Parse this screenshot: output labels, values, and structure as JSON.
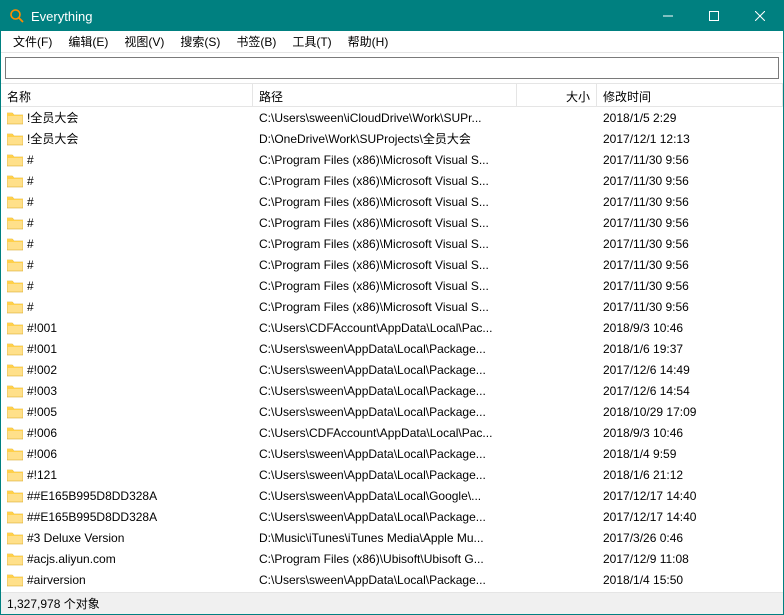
{
  "window": {
    "title": "Everything"
  },
  "menu": {
    "items": [
      {
        "label": "文件(F)"
      },
      {
        "label": "编辑(E)"
      },
      {
        "label": "视图(V)"
      },
      {
        "label": "搜索(S)"
      },
      {
        "label": "书签(B)"
      },
      {
        "label": "工具(T)"
      },
      {
        "label": "帮助(H)"
      }
    ]
  },
  "search": {
    "value": "",
    "placeholder": ""
  },
  "columns": {
    "name": "名称",
    "path": "路径",
    "size": "大小",
    "date": "修改时间"
  },
  "rows": [
    {
      "name": "!全员大会",
      "path": "C:\\Users\\sween\\iCloudDrive\\Work\\SUPr...",
      "size": "",
      "date": "2018/1/5 2:29"
    },
    {
      "name": "!全员大会",
      "path": "D:\\OneDrive\\Work\\SUProjects\\全员大会",
      "size": "",
      "date": "2017/12/1 12:13"
    },
    {
      "name": "#",
      "path": "C:\\Program Files (x86)\\Microsoft Visual S...",
      "size": "",
      "date": "2017/11/30 9:56"
    },
    {
      "name": "#",
      "path": "C:\\Program Files (x86)\\Microsoft Visual S...",
      "size": "",
      "date": "2017/11/30 9:56"
    },
    {
      "name": "#",
      "path": "C:\\Program Files (x86)\\Microsoft Visual S...",
      "size": "",
      "date": "2017/11/30 9:56"
    },
    {
      "name": "#",
      "path": "C:\\Program Files (x86)\\Microsoft Visual S...",
      "size": "",
      "date": "2017/11/30 9:56"
    },
    {
      "name": "#",
      "path": "C:\\Program Files (x86)\\Microsoft Visual S...",
      "size": "",
      "date": "2017/11/30 9:56"
    },
    {
      "name": "#",
      "path": "C:\\Program Files (x86)\\Microsoft Visual S...",
      "size": "",
      "date": "2017/11/30 9:56"
    },
    {
      "name": "#",
      "path": "C:\\Program Files (x86)\\Microsoft Visual S...",
      "size": "",
      "date": "2017/11/30 9:56"
    },
    {
      "name": "#",
      "path": "C:\\Program Files (x86)\\Microsoft Visual S...",
      "size": "",
      "date": "2017/11/30 9:56"
    },
    {
      "name": "#!001",
      "path": "C:\\Users\\CDFAccount\\AppData\\Local\\Pac...",
      "size": "",
      "date": "2018/9/3 10:46"
    },
    {
      "name": "#!001",
      "path": "C:\\Users\\sween\\AppData\\Local\\Package...",
      "size": "",
      "date": "2018/1/6 19:37"
    },
    {
      "name": "#!002",
      "path": "C:\\Users\\sween\\AppData\\Local\\Package...",
      "size": "",
      "date": "2017/12/6 14:49"
    },
    {
      "name": "#!003",
      "path": "C:\\Users\\sween\\AppData\\Local\\Package...",
      "size": "",
      "date": "2017/12/6 14:54"
    },
    {
      "name": "#!005",
      "path": "C:\\Users\\sween\\AppData\\Local\\Package...",
      "size": "",
      "date": "2018/10/29 17:09"
    },
    {
      "name": "#!006",
      "path": "C:\\Users\\CDFAccount\\AppData\\Local\\Pac...",
      "size": "",
      "date": "2018/9/3 10:46"
    },
    {
      "name": "#!006",
      "path": "C:\\Users\\sween\\AppData\\Local\\Package...",
      "size": "",
      "date": "2018/1/4 9:59"
    },
    {
      "name": "#!121",
      "path": "C:\\Users\\sween\\AppData\\Local\\Package...",
      "size": "",
      "date": "2018/1/6 21:12"
    },
    {
      "name": "##E165B995D8DD328A",
      "path": "C:\\Users\\sween\\AppData\\Local\\Google\\...",
      "size": "",
      "date": "2017/12/17 14:40"
    },
    {
      "name": "##E165B995D8DD328A",
      "path": "C:\\Users\\sween\\AppData\\Local\\Package...",
      "size": "",
      "date": "2017/12/17 14:40"
    },
    {
      "name": "#3 Deluxe Version",
      "path": "D:\\Music\\iTunes\\iTunes Media\\Apple Mu...",
      "size": "",
      "date": "2017/3/26 0:46"
    },
    {
      "name": "#acjs.aliyun.com",
      "path": "C:\\Program Files (x86)\\Ubisoft\\Ubisoft G...",
      "size": "",
      "date": "2017/12/9 11:08"
    },
    {
      "name": "#airversion",
      "path": "C:\\Users\\sween\\AppData\\Local\\Package...",
      "size": "",
      "date": "2018/1/4 15:50"
    }
  ],
  "status": {
    "text": "1,327,978 个对象"
  }
}
